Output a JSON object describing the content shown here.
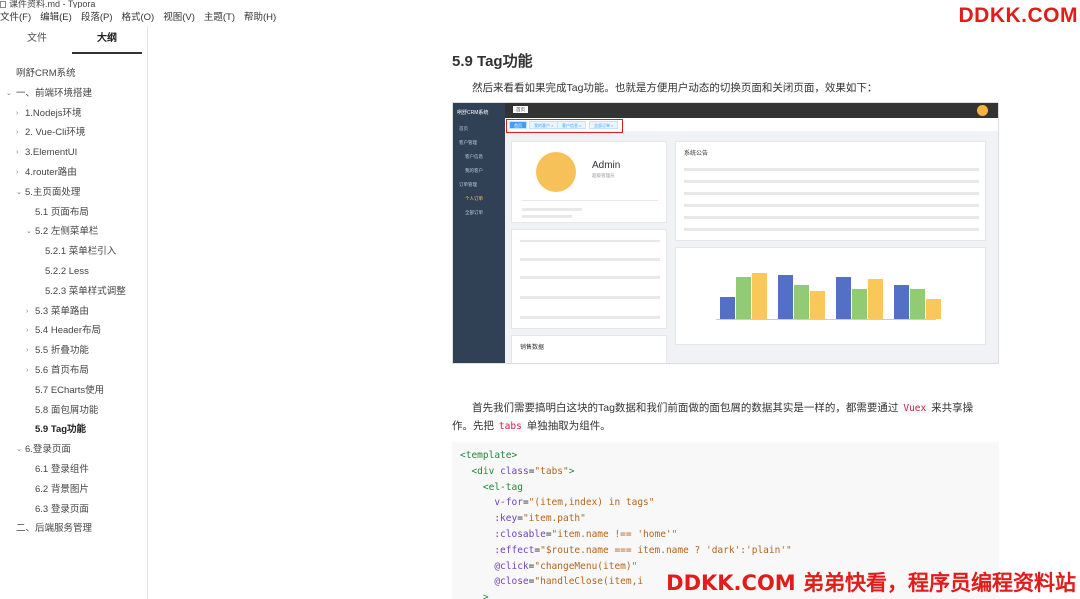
{
  "window": {
    "title": "课件资料.md - Typora"
  },
  "menubar": [
    "文件(F)",
    "编辑(E)",
    "段落(P)",
    "格式(O)",
    "视图(V)",
    "主题(T)",
    "帮助(H)"
  ],
  "watermarks": {
    "top": "DDKK.COM",
    "bottom": "DDKK.COM 弟弟快看，程序员编程资料站"
  },
  "sidebar": {
    "tabs": [
      {
        "label": "文件",
        "active": false
      },
      {
        "label": "大纲",
        "active": true
      }
    ],
    "outline": [
      {
        "label": "咧舒CRM系统",
        "level": 0,
        "arrow": ""
      },
      {
        "label": "一、前端环境搭建",
        "level": 0,
        "arrow": "⌄"
      },
      {
        "label": "1.Nodejs环境",
        "level": 1,
        "arrow": "›"
      },
      {
        "label": "2. Vue-Cli环境",
        "level": 1,
        "arrow": "›"
      },
      {
        "label": "3.ElementUI",
        "level": 1,
        "arrow": "›"
      },
      {
        "label": "4.router路由",
        "level": 1,
        "arrow": "›"
      },
      {
        "label": "5.主页面处理",
        "level": 1,
        "arrow": "⌄"
      },
      {
        "label": "5.1 页面布局",
        "level": 2,
        "arrow": ""
      },
      {
        "label": "5.2 左侧菜单栏",
        "level": 2,
        "arrow": "⌄"
      },
      {
        "label": "5.2.1 菜单栏引入",
        "level": 3,
        "arrow": ""
      },
      {
        "label": "5.2.2 Less",
        "level": 3,
        "arrow": ""
      },
      {
        "label": "5.2.3 菜单样式调整",
        "level": 3,
        "arrow": ""
      },
      {
        "label": "5.3 菜单路由",
        "level": 2,
        "arrow": "›"
      },
      {
        "label": "5.4 Header布局",
        "level": 2,
        "arrow": "›"
      },
      {
        "label": "5.5 折叠功能",
        "level": 2,
        "arrow": "›"
      },
      {
        "label": "5.6 首页布局",
        "level": 2,
        "arrow": "›"
      },
      {
        "label": "5.7 ECharts使用",
        "level": 2,
        "arrow": ""
      },
      {
        "label": "5.8 面包屑功能",
        "level": 2,
        "arrow": ""
      },
      {
        "label": "5.9 Tag功能",
        "level": 2,
        "arrow": "",
        "current": true
      },
      {
        "label": "6.登录页面",
        "level": 1,
        "arrow": "⌄"
      },
      {
        "label": "6.1 登录组件",
        "level": 2,
        "arrow": ""
      },
      {
        "label": "6.2 背景图片",
        "level": 2,
        "arrow": ""
      },
      {
        "label": "6.3 登录页面",
        "level": 2,
        "arrow": ""
      },
      {
        "label": "二、后端服务管理",
        "level": 0,
        "arrow": ""
      }
    ]
  },
  "doc": {
    "heading": "5.9 Tag功能",
    "intro": "然后来看看如果完成Tag功能。也就是方便用户动态的切换页面和关闭页面，效果如下：",
    "para_a": "首先我们需要搞明白这块的Tag数据和我们前面做的面包屑的数据其实是一样的，都需要通过",
    "para_vuex": "Vuex",
    "para_b": "来共享操",
    "para_c": "作。先把",
    "para_tabs": "tabs",
    "para_d": "单独抽取为组件。"
  },
  "screenshot": {
    "logo": "咧舒CRM系统",
    "menu": [
      {
        "label": "首页",
        "sub": false,
        "on": false
      },
      {
        "label": "客户管理",
        "sub": false,
        "on": false
      },
      {
        "label": "客户信息",
        "sub": true,
        "on": false
      },
      {
        "label": "我的客户",
        "sub": true,
        "on": false
      },
      {
        "label": "订单管理",
        "sub": false,
        "on": false
      },
      {
        "label": "个人订单",
        "sub": true,
        "on": true
      },
      {
        "label": "全部订单",
        "sub": true,
        "on": false
      }
    ],
    "home_tab": "首页",
    "tags": [
      "首页",
      "我的客户 ×",
      "客户信息 ×",
      "全部订单 ×"
    ],
    "admin_name": "Admin",
    "admin_role": "超级管理员",
    "notice_title": "系统公告",
    "sales_title": "销售数据"
  },
  "code": [
    [
      [
        "t-tag",
        "<template>"
      ]
    ],
    [
      [
        "t-plain",
        "  "
      ],
      [
        "t-tag",
        "<div"
      ],
      [
        "t-plain",
        " "
      ],
      [
        "t-attr",
        "class"
      ],
      [
        "t-plain",
        "="
      ],
      [
        "t-str",
        "\"tabs\""
      ],
      [
        "t-tag",
        ">"
      ]
    ],
    [
      [
        "t-plain",
        "    "
      ],
      [
        "t-tag",
        "<el-tag"
      ]
    ],
    [
      [
        "t-plain",
        "      "
      ],
      [
        "t-attr",
        "v-for"
      ],
      [
        "t-plain",
        "="
      ],
      [
        "t-str",
        "\"(item,index) in tags\""
      ]
    ],
    [
      [
        "t-plain",
        "      "
      ],
      [
        "t-attr",
        ":key"
      ],
      [
        "t-plain",
        "="
      ],
      [
        "t-str",
        "\"item.path\""
      ]
    ],
    [
      [
        "t-plain",
        "      "
      ],
      [
        "t-attr",
        ":closable"
      ],
      [
        "t-plain",
        "="
      ],
      [
        "t-str",
        "\"item.name !== 'home'\""
      ]
    ],
    [
      [
        "t-plain",
        "      "
      ],
      [
        "t-attr",
        ":effect"
      ],
      [
        "t-plain",
        "="
      ],
      [
        "t-str",
        "\"$route.name === item.name ? 'dark':'plain'\""
      ]
    ],
    [
      [
        "t-plain",
        "      "
      ],
      [
        "t-attr",
        "@click"
      ],
      [
        "t-plain",
        "="
      ],
      [
        "t-str",
        "\"changeMenu(item)\""
      ]
    ],
    [
      [
        "t-plain",
        "      "
      ],
      [
        "t-attr",
        "@close"
      ],
      [
        "t-plain",
        "="
      ],
      [
        "t-str",
        "\"handleClose(item,i"
      ]
    ],
    [
      [
        "t-plain",
        "    "
      ],
      [
        "t-tag",
        ">"
      ]
    ]
  ]
}
